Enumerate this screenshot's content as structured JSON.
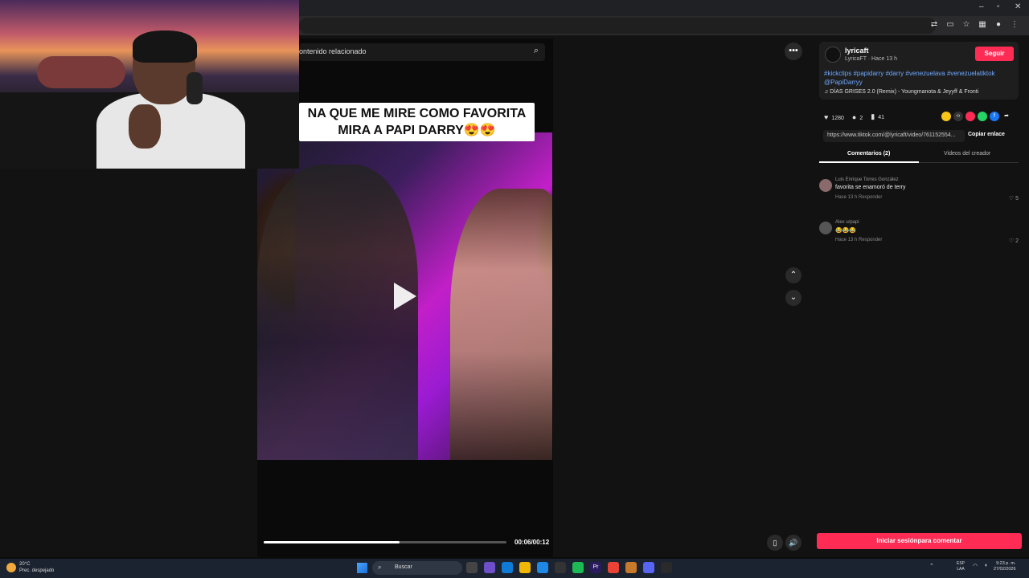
{
  "window": {
    "minimize": "–",
    "maximize": "▫",
    "close": "✕"
  },
  "search_related": {
    "placeholder": "ontenido relacionado",
    "search_icon": "search-icon"
  },
  "video": {
    "caption_line1": "NA QUE ME MIRE COMO FAVORITA",
    "caption_line2": "MIRA A PAPI DARRY😍😍",
    "time": "00:06/00:12",
    "progress": 0.56
  },
  "controls": {
    "more": "•••",
    "up": "⌃",
    "down": "⌄",
    "mute": "▯",
    "volume": "🔊"
  },
  "creator": {
    "name": "lyricaft",
    "sub": "LyricaFT · Hace 13 h",
    "follow": "Seguir",
    "hashtags": "#kickclips #papidarry #darry #venezuelava #venezuelatiktok @PapiDarryy",
    "music": "♫  DÍAS GRISES 2.0 (Remix) - Youngmanota & Jeyyff & Fronti"
  },
  "stats": {
    "likes": "1280",
    "comments": "2",
    "saves": "41"
  },
  "link": {
    "url": "https://www.tiktok.com/@lyricaft/video/761152554...",
    "copy": "Copiar enlace"
  },
  "tabs": {
    "comments": "Comentarios (2)",
    "creator_videos": "Videos del creador"
  },
  "comments": [
    {
      "user": "Luis Enrique Torres González",
      "text": "favorita se enamoró de terry",
      "meta": "Hace 13 h     Responder",
      "likes": "♡ 5"
    },
    {
      "user": "Alex u/papi",
      "text": "😂😂😂",
      "meta": "Hace 13 h     Responder",
      "likes": "♡ 2"
    }
  ],
  "login": "Iniciar sesiónpara comentar",
  "taskbar": {
    "temp": "20°C",
    "weather": "Prec. despejado",
    "search": "Buscar",
    "lang1": "ESP",
    "lang2": "LAA",
    "time": "9:23 p. m.",
    "date": "27/02/2026"
  }
}
